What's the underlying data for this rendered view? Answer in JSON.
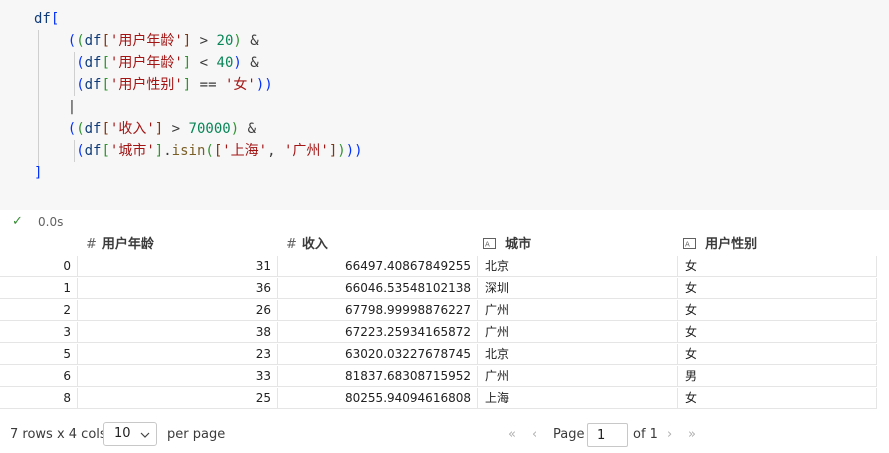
{
  "code": {
    "lines": [
      "df[",
      "    ((df['用户年龄'] > 20) &",
      "     (df['用户年龄'] < 40) &",
      "     (df['用户性别'] == '女'))",
      "    |",
      "    ((df['收入'] > 70000) &",
      "     (df['城市'].isin(['上海', '广州'])))",
      "]"
    ]
  },
  "status": {
    "time": "0.0s"
  },
  "table": {
    "headers": [
      {
        "icon": "number-type-icon",
        "label": "用户年龄"
      },
      {
        "icon": "number-type-icon",
        "label": "收入"
      },
      {
        "icon": "text-type-icon",
        "label": "城市"
      },
      {
        "icon": "text-type-icon",
        "label": "用户性别"
      }
    ],
    "rows": [
      {
        "index": "0",
        "age": "31",
        "income": "66497.40867849255",
        "city": "北京",
        "gender": "女"
      },
      {
        "index": "1",
        "age": "36",
        "income": "66046.53548102138",
        "city": "深圳",
        "gender": "女"
      },
      {
        "index": "2",
        "age": "26",
        "income": "67798.99998876227",
        "city": "广州",
        "gender": "女"
      },
      {
        "index": "3",
        "age": "38",
        "income": "67223.25934165872",
        "city": "广州",
        "gender": "女"
      },
      {
        "index": "5",
        "age": "23",
        "income": "63020.03227678745",
        "city": "北京",
        "gender": "女"
      },
      {
        "index": "6",
        "age": "33",
        "income": "81837.68308715952",
        "city": "广州",
        "gender": "男"
      },
      {
        "index": "8",
        "age": "25",
        "income": "80255.94094616808",
        "city": "上海",
        "gender": "女"
      }
    ]
  },
  "footer": {
    "summary": "7 rows x 4 cols",
    "page_size": "10",
    "per_page": "per page",
    "page_label": "Page",
    "page_value": "1",
    "of_label": "of 1"
  }
}
